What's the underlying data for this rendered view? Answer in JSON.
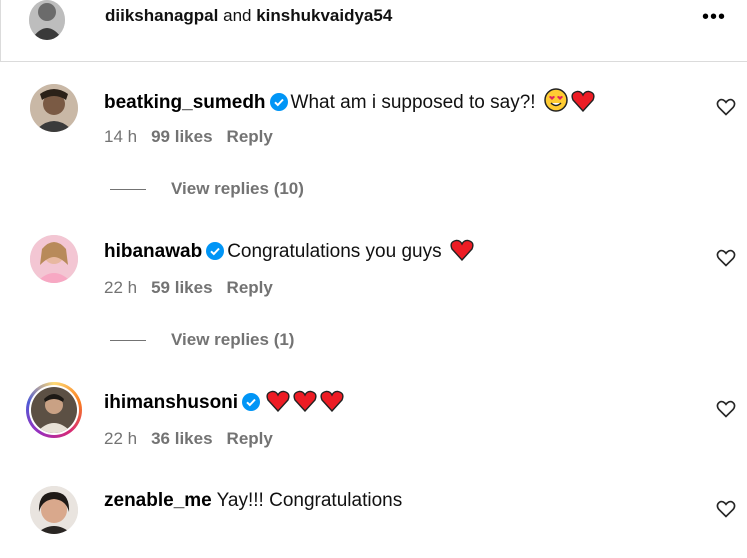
{
  "header": {
    "user1": "diikshanagpal",
    "and": "and",
    "user2": "kinshukvaidya54",
    "more_icon": "more-horizontal-icon"
  },
  "comments": [
    {
      "username": "beatking_sumedh",
      "verified": true,
      "text": "What am i supposed to say?!",
      "emojis": [
        "heart-eyes-emoji",
        "red-heart-emoji"
      ],
      "time": "14 h",
      "likes": "99 likes",
      "reply": "Reply",
      "view_replies": "View replies (10)"
    },
    {
      "username": "hibanawab",
      "verified": true,
      "text": "Congratulations you guys",
      "emojis": [
        "red-heart-emoji"
      ],
      "time": "22 h",
      "likes": "59 likes",
      "reply": "Reply",
      "view_replies": "View replies (1)"
    },
    {
      "username": "ihimanshusoni",
      "verified": true,
      "text": "",
      "emojis": [
        "red-heart-emoji",
        "red-heart-emoji",
        "red-heart-emoji"
      ],
      "time": "22 h",
      "likes": "36 likes",
      "reply": "Reply"
    },
    {
      "username": "zenable_me",
      "verified": false,
      "text": "Yay!!! Congratulations"
    }
  ],
  "colors": {
    "verified_blue": "#0095f6",
    "heart_red": "#ed1c24",
    "meta_gray": "#737373",
    "divider": "#dbdbdb"
  }
}
